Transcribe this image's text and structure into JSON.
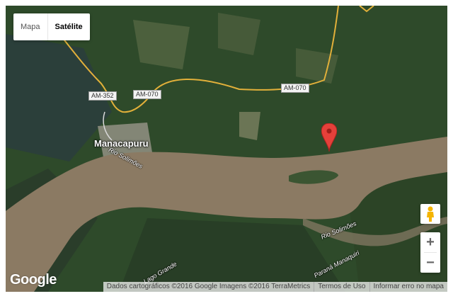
{
  "map_type": {
    "map_label": "Mapa",
    "satellite_label": "Satélite",
    "selected": "Satélite"
  },
  "places": {
    "city": "Manacapuru"
  },
  "roads": {
    "r1": "AM-352",
    "r2": "AM-070",
    "r3": "AM-070"
  },
  "rivers": {
    "r1": "Rio Solimões",
    "r2": "Rio Solimões",
    "lake": "Lago Grande",
    "parana": "Paraná Manaquiri"
  },
  "logo": "Google",
  "attribution": {
    "data": "Dados cartográficos ©2016 Google Imagens ©2016 TerraMetrics",
    "terms": "Termos de Uso",
    "report": "Informar erro no mapa"
  },
  "zoom": {
    "in": "+",
    "out": "−"
  },
  "colors": {
    "forest": "#2f4a2a",
    "river": "#8b7a63",
    "road": "#e2b03a",
    "pin": "#e5403a"
  },
  "icons": {
    "pin": "map-marker-icon",
    "pegman": "pegman-icon"
  }
}
